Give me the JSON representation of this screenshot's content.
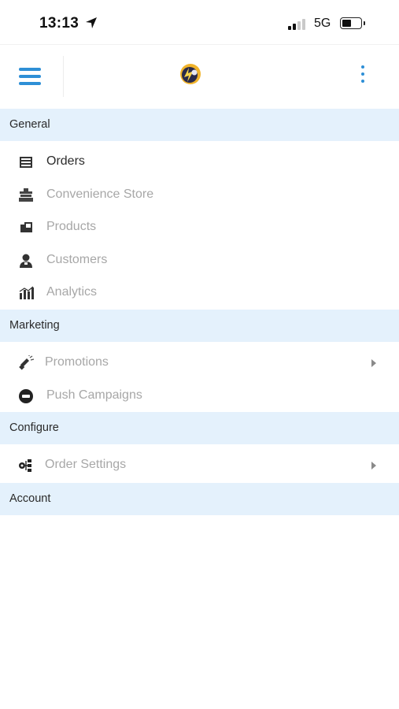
{
  "status_bar": {
    "time": "13:13",
    "network": "5G"
  },
  "header": {
    "menu_icon": "hamburger-icon",
    "logo_icon": "app-logo",
    "more_icon": "more-vertical-icon"
  },
  "sections": {
    "general": "General",
    "marketing": "Marketing",
    "configure": "Configure",
    "account": "Account"
  },
  "items": {
    "orders": {
      "label": "Orders",
      "icon": "orders-list-icon"
    },
    "convenience_store": {
      "label": "Convenience Store",
      "icon": "store-icon"
    },
    "products": {
      "label": "Products",
      "icon": "products-icon"
    },
    "customers": {
      "label": "Customers",
      "icon": "customer-icon"
    },
    "analytics": {
      "label": "Analytics",
      "icon": "bar-chart-icon"
    },
    "promotions": {
      "label": "Promotions",
      "icon": "megaphone-icon"
    },
    "push_campaigns": {
      "label": "Push Campaigns",
      "icon": "push-badge-icon"
    },
    "order_settings": {
      "label": "Order Settings",
      "icon": "settings-hierarchy-icon"
    }
  },
  "colors": {
    "accent": "#2e8fd6",
    "section_bg": "#e4f1fc",
    "active_text": "#2c2c2c",
    "inactive_text": "#a7a7a7"
  }
}
